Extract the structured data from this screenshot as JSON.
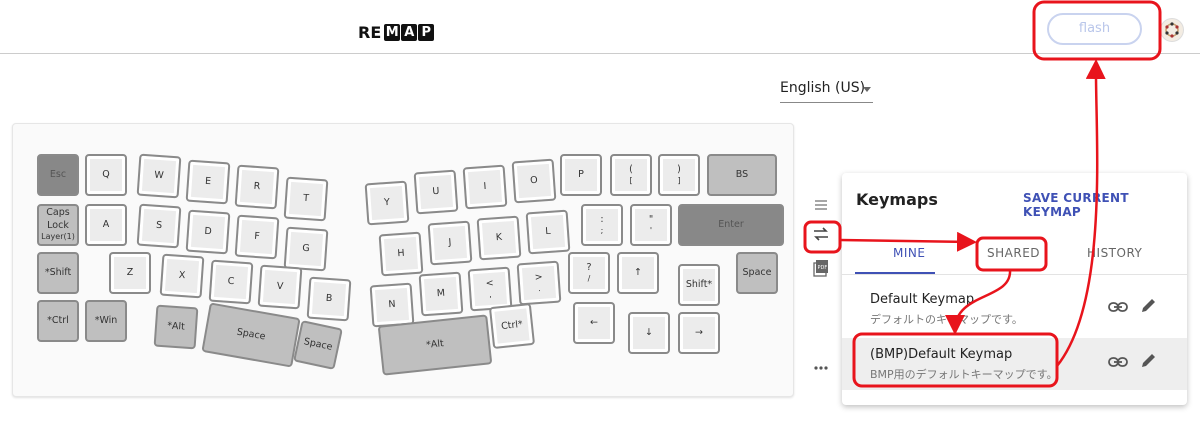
{
  "header": {
    "logo_plain": "RE",
    "logo_boxed": [
      "M",
      "A",
      "P"
    ],
    "flash_label": "flash"
  },
  "language": {
    "selected": "English (US)"
  },
  "keyboard": {
    "keys": [
      {
        "label": "Esc",
        "sub": "",
        "style": "dark"
      },
      {
        "label": "Q",
        "sub": "",
        "style": "inner"
      },
      {
        "label": "W",
        "sub": "",
        "style": "inner"
      },
      {
        "label": "E",
        "sub": "",
        "style": "inner"
      },
      {
        "label": "R",
        "sub": "",
        "style": "inner"
      },
      {
        "label": "T",
        "sub": "",
        "style": "inner"
      },
      {
        "label": "Caps Lock",
        "sub": "Layer(1)",
        "style": "mid"
      },
      {
        "label": "A",
        "sub": "",
        "style": "inner"
      },
      {
        "label": "S",
        "sub": "",
        "style": "inner"
      },
      {
        "label": "D",
        "sub": "",
        "style": "inner"
      },
      {
        "label": "F",
        "sub": "",
        "style": "inner"
      },
      {
        "label": "G",
        "sub": "",
        "style": "inner"
      },
      {
        "label": "*Shift",
        "sub": "",
        "style": "mid"
      },
      {
        "label": "Z",
        "sub": "",
        "style": "inner"
      },
      {
        "label": "X",
        "sub": "",
        "style": "inner"
      },
      {
        "label": "C",
        "sub": "",
        "style": "inner"
      },
      {
        "label": "V",
        "sub": "",
        "style": "inner"
      },
      {
        "label": "B",
        "sub": "",
        "style": "inner"
      },
      {
        "label": "*Ctrl",
        "sub": "",
        "style": "mid"
      },
      {
        "label": "*Win",
        "sub": "",
        "style": "mid"
      },
      {
        "label": "*Alt",
        "sub": "",
        "style": "mid"
      },
      {
        "label": "Space",
        "sub": "",
        "style": "mid"
      },
      {
        "label": "Space",
        "sub": "",
        "style": "mid"
      },
      {
        "label": "Y",
        "sub": "",
        "style": "inner"
      },
      {
        "label": "U",
        "sub": "",
        "style": "inner"
      },
      {
        "label": "I",
        "sub": "",
        "style": "inner"
      },
      {
        "label": "O",
        "sub": "",
        "style": "inner"
      },
      {
        "label": "P",
        "sub": "",
        "style": "inner"
      },
      {
        "label": "(",
        "sub": "[",
        "style": "inner"
      },
      {
        "label": ")",
        "sub": "]",
        "style": "inner"
      },
      {
        "label": "BS",
        "sub": "",
        "style": "mid"
      },
      {
        "label": "H",
        "sub": "",
        "style": "inner"
      },
      {
        "label": "J",
        "sub": "",
        "style": "inner"
      },
      {
        "label": "K",
        "sub": "",
        "style": "inner"
      },
      {
        "label": "L",
        "sub": "",
        "style": "inner"
      },
      {
        "label": ":",
        "sub": ";",
        "style": "inner"
      },
      {
        "label": "\"",
        "sub": "'",
        "style": "inner"
      },
      {
        "label": "Enter",
        "sub": "",
        "style": "dark"
      },
      {
        "label": "N",
        "sub": "",
        "style": "inner"
      },
      {
        "label": "M",
        "sub": "",
        "style": "inner"
      },
      {
        "label": "<",
        "sub": ",",
        "style": "inner"
      },
      {
        "label": ">",
        "sub": ".",
        "style": "inner"
      },
      {
        "label": "?",
        "sub": "/",
        "style": "inner"
      },
      {
        "label": "↑",
        "sub": "",
        "style": "inner"
      },
      {
        "label": "Shift*",
        "sub": "",
        "style": "inner"
      },
      {
        "label": "Space",
        "sub": "",
        "style": "mid"
      },
      {
        "label": "*Alt",
        "sub": "",
        "style": "mid"
      },
      {
        "label": "Ctrl*",
        "sub": "",
        "style": "inner"
      },
      {
        "label": "←",
        "sub": "",
        "style": "inner"
      },
      {
        "label": "↓",
        "sub": "",
        "style": "inner"
      },
      {
        "label": "→",
        "sub": "",
        "style": "inner"
      }
    ]
  },
  "side_icons": [
    "list-icon",
    "swap-icon",
    "pdf-icon",
    "more-icon"
  ],
  "keymaps": {
    "title": "Keymaps",
    "save_label": "SAVE CURRENT KEYMAP",
    "tabs": [
      {
        "label": "MINE",
        "active": true
      },
      {
        "label": "SHARED",
        "active": false
      },
      {
        "label": "HISTORY",
        "active": false
      }
    ],
    "items": [
      {
        "title": "Default Keymap",
        "desc": "デフォルトのキーマップです。",
        "selected": false
      },
      {
        "title": "(BMP)Default Keymap",
        "desc": "BMP用のデフォルトキーマップです。",
        "selected": true
      }
    ]
  },
  "colors": {
    "accent": "#3f51b5",
    "annotation": "#e8141c"
  }
}
